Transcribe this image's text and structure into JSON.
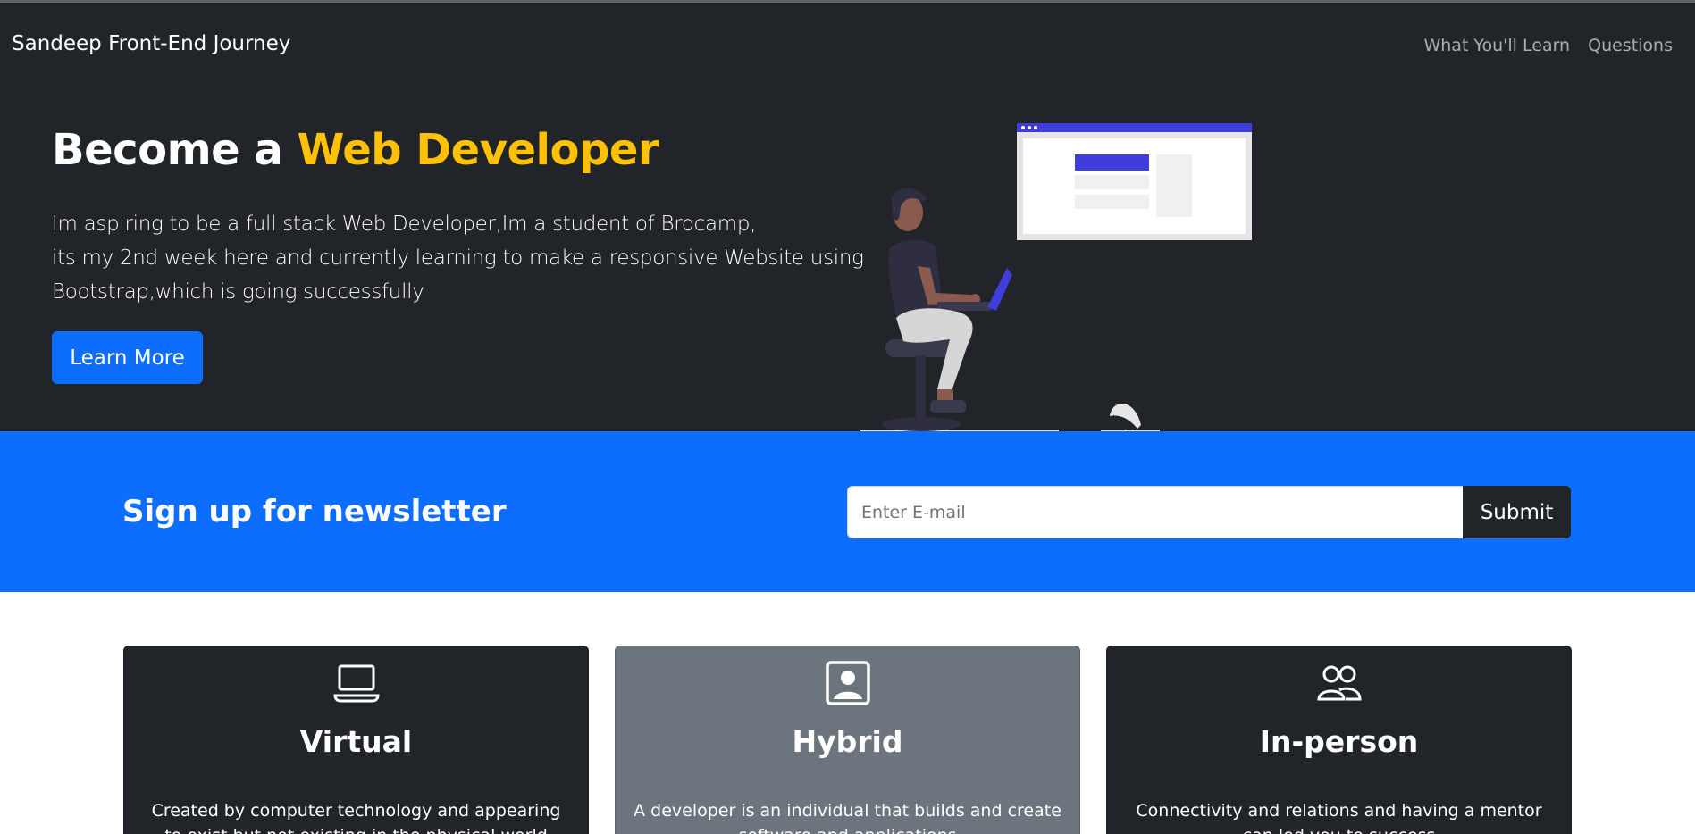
{
  "navbar": {
    "brand": "Sandeep Front-End Journey",
    "links": [
      "What You'll Learn",
      "Questions"
    ]
  },
  "hero": {
    "title_prefix": "Become a ",
    "title_accent": "Web Developer",
    "text_lines": [
      "Im aspiring to be a full stack Web Developer,Im a student of Brocamp,",
      "its my 2nd week here and currently learning to make a responsive Website using",
      "Bootstrap,which is going successfully"
    ],
    "button_label": "Learn More",
    "illustration_icon": "person-with-laptop-illustration"
  },
  "newsletter": {
    "title": "Sign up for newsletter",
    "input_placeholder": "Enter E-mail",
    "input_value": "",
    "submit_label": "Submit"
  },
  "cards": [
    {
      "icon": "laptop-icon",
      "title": "Virtual",
      "text": "Created by computer technology and appearing to exist but not existing in the physical world",
      "style": "dark"
    },
    {
      "icon": "person-square-icon",
      "title": "Hybrid",
      "text": "A developer is an individual that builds and create software and applications",
      "style": "gray"
    },
    {
      "icon": "people-icon",
      "title": "In-person",
      "text": "Connectivity and relations and having a mentor can led you to success",
      "style": "dark"
    }
  ],
  "colors": {
    "dark": "#212529",
    "primary": "#0d6efd",
    "accent": "#ffc107",
    "secondary": "#6c757d"
  }
}
